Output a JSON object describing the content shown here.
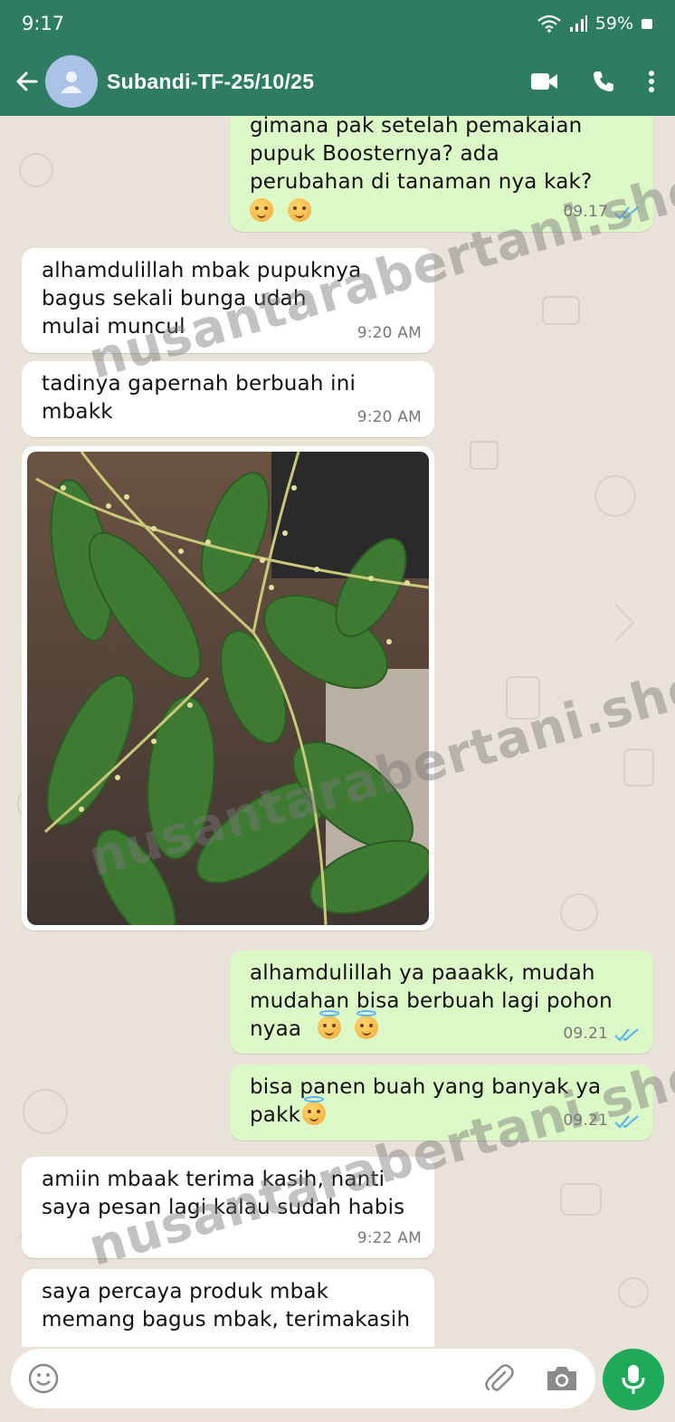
{
  "status_bar": {
    "time": "9:17",
    "battery": "59%"
  },
  "header": {
    "contact_name": "Subandi-TF-25/10/25"
  },
  "messages": [
    {
      "type": "out",
      "text_lines": [
        "gimana pak setelah pemakaian",
        "pupuk Boosternya? ada",
        "perubahan di tanaman nya kak?"
      ],
      "emoji": "😊 😊",
      "time": "09.17"
    },
    {
      "type": "in",
      "text_lines": [
        "alhamdulillah mbak pupuknya",
        "bagus sekali bunga udah",
        "mulai muncul"
      ],
      "time": "9:20 AM"
    },
    {
      "type": "in",
      "text_lines": [
        "tadinya gapernah berbuah ini",
        "mbakk"
      ],
      "time": "9:20 AM"
    },
    {
      "type": "in-image"
    },
    {
      "type": "out",
      "text_lines": [
        "alhamdulillah ya paaakk, mudah",
        "mudahan bisa berbuah lagi pohon",
        "nyaa"
      ],
      "emoji": "😇 😇",
      "time": "09.21"
    },
    {
      "type": "out",
      "text_lines": [
        "bisa panen buah yang banyak ya",
        "pakk"
      ],
      "emoji": "😇",
      "time": "09.21"
    },
    {
      "type": "in",
      "text_lines": [
        "amiin mbaak terima kasih, nanti",
        "saya pesan lagi kalau sudah habis"
      ],
      "time": "9:22 AM"
    },
    {
      "type": "in",
      "text_lines": [
        "saya percaya produk mbak",
        "memang bagus mbak, terimakasih"
      ]
    }
  ],
  "watermark": "nusantarabertani.shop",
  "colors": {
    "header": "#2e7d63",
    "outgoing": "#dcf8c6",
    "incoming": "#ffffff",
    "ticks": "#4fb3f2",
    "mic": "#1faa59"
  },
  "icons": [
    "back-arrow-icon",
    "person-icon",
    "video-call-icon",
    "phone-icon",
    "more-vert-icon",
    "emoji-icon",
    "attach-icon",
    "camera-icon",
    "mic-icon"
  ]
}
